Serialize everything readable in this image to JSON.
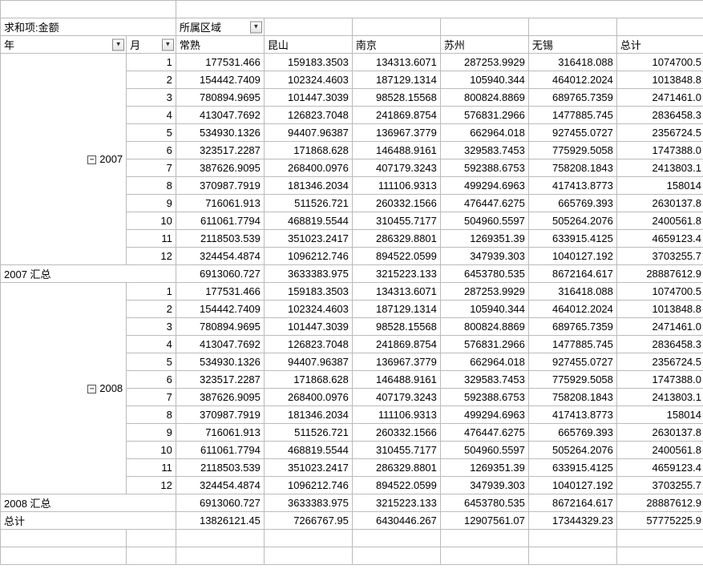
{
  "header": {
    "measure_label": "求和项:金额",
    "col_field_label": "所属区域",
    "row_year_label": "年",
    "row_month_label": "月",
    "regions": [
      "常熟",
      "昆山",
      "南京",
      "苏州",
      "无锡"
    ],
    "total_label": "总计"
  },
  "years": [
    {
      "year": "2007",
      "subtotal_label": "2007 汇总",
      "months": [
        {
          "m": "1",
          "v": [
            "177531.466",
            "159183.3503",
            "134313.6071",
            "287253.9929",
            "316418.088",
            "1074700.5"
          ]
        },
        {
          "m": "2",
          "v": [
            "154442.7409",
            "102324.4603",
            "187129.1314",
            "105940.344",
            "464012.2024",
            "1013848.8"
          ]
        },
        {
          "m": "3",
          "v": [
            "780894.9695",
            "101447.3039",
            "98528.15568",
            "800824.8869",
            "689765.7359",
            "2471461.0"
          ]
        },
        {
          "m": "4",
          "v": [
            "413047.7692",
            "126823.7048",
            "241869.8754",
            "576831.2966",
            "1477885.745",
            "2836458.3"
          ]
        },
        {
          "m": "5",
          "v": [
            "534930.1326",
            "94407.96387",
            "136967.3779",
            "662964.018",
            "927455.0727",
            "2356724.5"
          ]
        },
        {
          "m": "6",
          "v": [
            "323517.2287",
            "171868.628",
            "146488.9161",
            "329583.7453",
            "775929.5058",
            "1747388.0"
          ]
        },
        {
          "m": "7",
          "v": [
            "387626.9095",
            "268400.0976",
            "407179.3243",
            "592388.6753",
            "758208.1843",
            "2413803.1"
          ]
        },
        {
          "m": "8",
          "v": [
            "370987.7919",
            "181346.2034",
            "111106.9313",
            "499294.6963",
            "417413.8773",
            "158014"
          ]
        },
        {
          "m": "9",
          "v": [
            "716061.913",
            "511526.721",
            "260332.1566",
            "476447.6275",
            "665769.393",
            "2630137.8"
          ]
        },
        {
          "m": "10",
          "v": [
            "611061.7794",
            "468819.5544",
            "310455.7177",
            "504960.5597",
            "505264.2076",
            "2400561.8"
          ]
        },
        {
          "m": "11",
          "v": [
            "2118503.539",
            "351023.2417",
            "286329.8801",
            "1269351.39",
            "633915.4125",
            "4659123.4"
          ]
        },
        {
          "m": "12",
          "v": [
            "324454.4874",
            "1096212.746",
            "894522.0599",
            "347939.303",
            "1040127.192",
            "3703255.7"
          ]
        }
      ],
      "subtotal": [
        "6913060.727",
        "3633383.975",
        "3215223.133",
        "6453780.535",
        "8672164.617",
        "28887612.9"
      ]
    },
    {
      "year": "2008",
      "subtotal_label": "2008 汇总",
      "months": [
        {
          "m": "1",
          "v": [
            "177531.466",
            "159183.3503",
            "134313.6071",
            "287253.9929",
            "316418.088",
            "1074700.5"
          ]
        },
        {
          "m": "2",
          "v": [
            "154442.7409",
            "102324.4603",
            "187129.1314",
            "105940.344",
            "464012.2024",
            "1013848.8"
          ]
        },
        {
          "m": "3",
          "v": [
            "780894.9695",
            "101447.3039",
            "98528.15568",
            "800824.8869",
            "689765.7359",
            "2471461.0"
          ]
        },
        {
          "m": "4",
          "v": [
            "413047.7692",
            "126823.7048",
            "241869.8754",
            "576831.2966",
            "1477885.745",
            "2836458.3"
          ]
        },
        {
          "m": "5",
          "v": [
            "534930.1326",
            "94407.96387",
            "136967.3779",
            "662964.018",
            "927455.0727",
            "2356724.5"
          ]
        },
        {
          "m": "6",
          "v": [
            "323517.2287",
            "171868.628",
            "146488.9161",
            "329583.7453",
            "775929.5058",
            "1747388.0"
          ]
        },
        {
          "m": "7",
          "v": [
            "387626.9095",
            "268400.0976",
            "407179.3243",
            "592388.6753",
            "758208.1843",
            "2413803.1"
          ]
        },
        {
          "m": "8",
          "v": [
            "370987.7919",
            "181346.2034",
            "111106.9313",
            "499294.6963",
            "417413.8773",
            "158014"
          ]
        },
        {
          "m": "9",
          "v": [
            "716061.913",
            "511526.721",
            "260332.1566",
            "476447.6275",
            "665769.393",
            "2630137.8"
          ]
        },
        {
          "m": "10",
          "v": [
            "611061.7794",
            "468819.5544",
            "310455.7177",
            "504960.5597",
            "505264.2076",
            "2400561.8"
          ]
        },
        {
          "m": "11",
          "v": [
            "2118503.539",
            "351023.2417",
            "286329.8801",
            "1269351.39",
            "633915.4125",
            "4659123.4"
          ]
        },
        {
          "m": "12",
          "v": [
            "324454.4874",
            "1096212.746",
            "894522.0599",
            "347939.303",
            "1040127.192",
            "3703255.7"
          ]
        }
      ],
      "subtotal": [
        "6913060.727",
        "3633383.975",
        "3215223.133",
        "6453780.535",
        "8672164.617",
        "28887612.9"
      ]
    }
  ],
  "grand_total_label": "总计",
  "grand_total": [
    "13826121.45",
    "7266767.95",
    "6430446.267",
    "12907561.07",
    "17344329.23",
    "57775225.9"
  ]
}
